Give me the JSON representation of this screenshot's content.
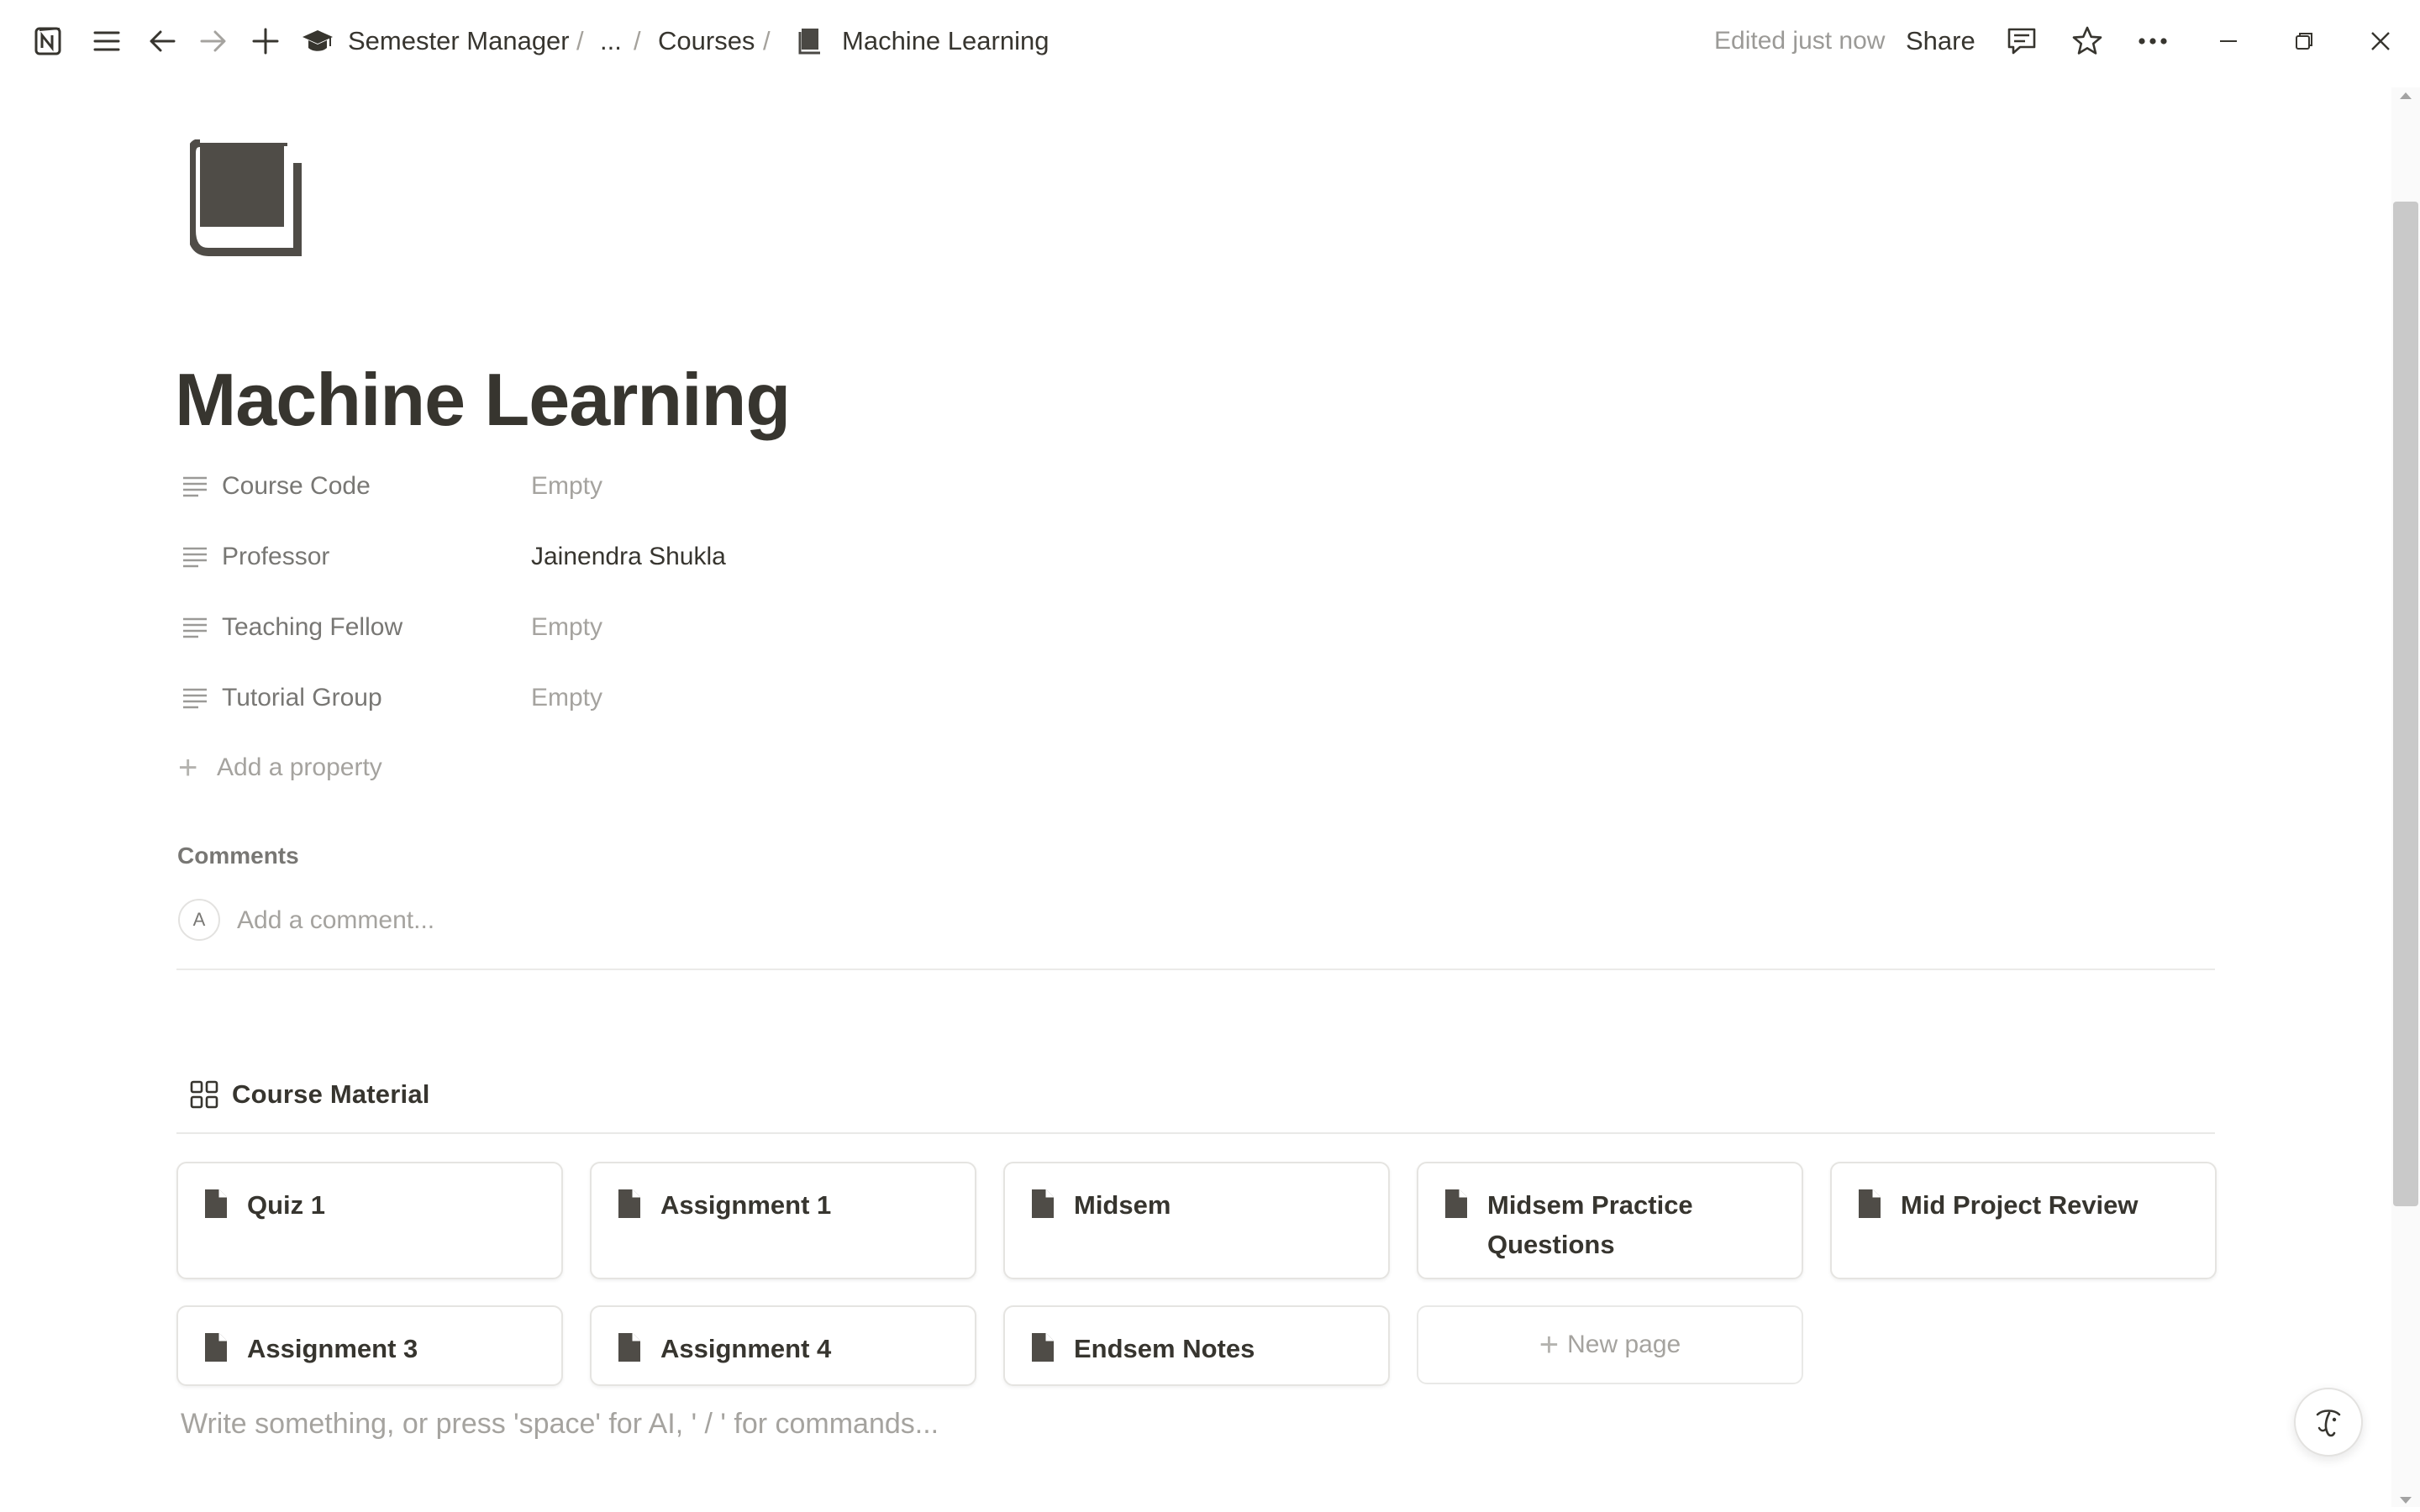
{
  "topbar": {
    "breadcrumb": {
      "workspace": "Semester Manager",
      "ellipsis": "...",
      "section": "Courses",
      "current": "Machine Learning"
    },
    "edited": "Edited just now",
    "share": "Share"
  },
  "page": {
    "title": "Machine Learning"
  },
  "properties": [
    {
      "name": "Course Code",
      "value": "Empty",
      "empty": true
    },
    {
      "name": "Professor",
      "value": "Jainendra Shukla",
      "empty": false
    },
    {
      "name": "Teaching Fellow",
      "value": "Empty",
      "empty": true
    },
    {
      "name": "Tutorial Group",
      "value": "Empty",
      "empty": true
    }
  ],
  "add_property": "Add a property",
  "comments": {
    "heading": "Comments",
    "avatar_initial": "A",
    "placeholder": "Add a comment..."
  },
  "course_material": {
    "title": "Course Material",
    "cards": [
      {
        "label": "Quiz 1"
      },
      {
        "label": "Assignment 1"
      },
      {
        "label": "Midsem"
      },
      {
        "label": "Midsem Practice Questions"
      },
      {
        "label": "Mid Project Review"
      },
      {
        "label": "Assignment 3"
      },
      {
        "label": "Assignment 4"
      },
      {
        "label": "Endsem Notes"
      }
    ],
    "new_page": "New page"
  },
  "editor_placeholder": "Write something, or press 'space' for AI, ' / ' for commands...",
  "colors": {
    "text": "#37352f",
    "muted": "#787774",
    "placeholder": "#a5a39f",
    "border": "#e5e4e1"
  }
}
